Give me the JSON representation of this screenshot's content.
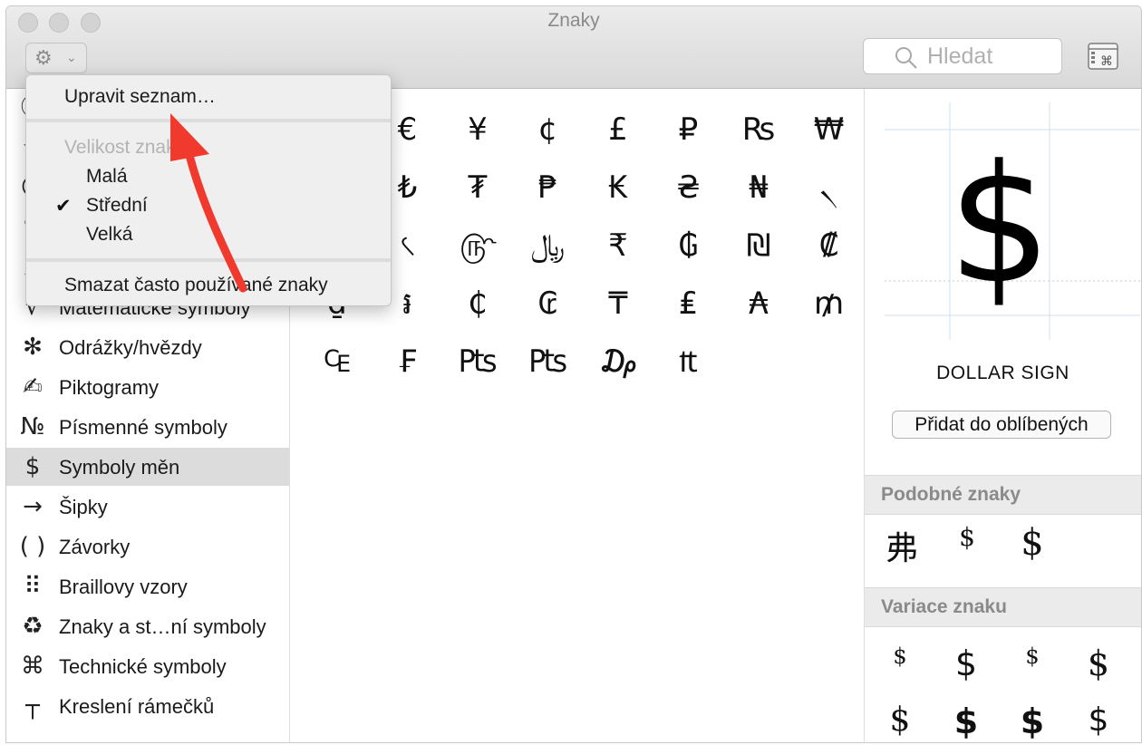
{
  "window": {
    "title": "Znaky"
  },
  "toolbar": {
    "search_placeholder": "Hledat"
  },
  "menu": {
    "edit_list": "Upravit seznam…",
    "size_header": "Velikost znaků",
    "size_options": [
      "Malá",
      "Střední",
      "Velká"
    ],
    "selected_size": "Střední",
    "clear_frequent": "Smazat často používané znaky"
  },
  "sidebar": {
    "items": [
      {
        "icon": "ⓒ",
        "label": ""
      },
      {
        "icon": "★",
        "label": ""
      },
      {
        "icon": "☺",
        "label": ""
      },
      {
        "icon": "✎",
        "label": ""
      },
      {
        "icon": "A",
        "label": ""
      },
      {
        "icon": "√",
        "label": "Matematické symboly"
      },
      {
        "icon": "✻",
        "label": "Odrážky/hvězdy"
      },
      {
        "icon": "✍",
        "label": "Piktogramy"
      },
      {
        "icon": "№",
        "label": "Písmenné symboly"
      },
      {
        "icon": "$",
        "label": "Symboly měn",
        "selected": true
      },
      {
        "icon": "→",
        "label": "Šipky"
      },
      {
        "icon": "( )",
        "label": "Závorky"
      },
      {
        "icon": "⠿",
        "label": "Braillovy vzory"
      },
      {
        "icon": "♻",
        "label": "Znaky a st…ní symboly"
      },
      {
        "icon": "⌘",
        "label": "Technické symboly"
      },
      {
        "icon": "┬",
        "label": "Kreslení rámečků"
      }
    ]
  },
  "grid": {
    "rows": [
      [
        "$",
        "€",
        "¥",
        "¢",
        "£",
        "₽",
        "₨",
        "₩"
      ],
      [
        "₴",
        "₺",
        "₮",
        "₱",
        "₭",
        "₴",
        "₦",
        "৲"
      ],
      [
        "৳",
        "৻",
        "௹",
        "﷼",
        "₹",
        "₲",
        "₪",
        "₡"
      ],
      [
        "₫",
        "៛",
        "₵",
        "₢",
        "₸",
        "₤",
        "₳",
        "₥"
      ],
      [
        "₠",
        "₣",
        "₧",
        "₧",
        "₯",
        "₶"
      ]
    ]
  },
  "details": {
    "preview_char": "$",
    "char_name": "DOLLAR SIGN",
    "add_favorite": "Přidat do oblíbených",
    "similar_header": "Podobné znaky",
    "similar": [
      "弗",
      "$",
      "$"
    ],
    "variants_header": "Variace znaku",
    "variants": [
      "$",
      "$",
      "$",
      "$",
      "$",
      "$",
      "$",
      "$"
    ]
  },
  "colors": {
    "arrow": "#f03a2e",
    "selected_row": "#dcdcdc"
  }
}
